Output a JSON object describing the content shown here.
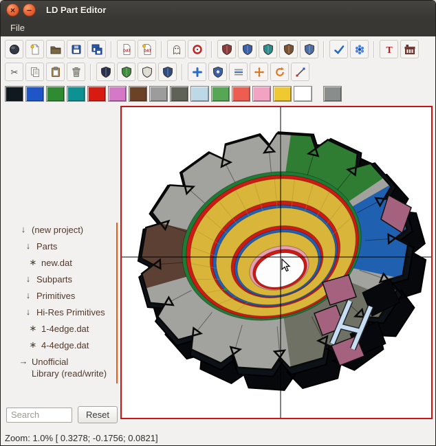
{
  "window": {
    "title": "LD Part Editor",
    "close_label": "×",
    "minimize_label": "–"
  },
  "menu": {
    "items": [
      {
        "label": "File"
      }
    ]
  },
  "toolbar_row1": {
    "items": [
      {
        "type": "button",
        "name": "manipulator-mode",
        "icon": "sphere"
      },
      {
        "type": "button",
        "name": "new-project",
        "icon": "page-new"
      },
      {
        "type": "button",
        "name": "open-file",
        "icon": "folder"
      },
      {
        "type": "button",
        "name": "save",
        "icon": "floppy"
      },
      {
        "type": "button",
        "name": "save-all",
        "icon": "floppy-multi"
      },
      {
        "type": "separator"
      },
      {
        "type": "button",
        "name": "new-dat-file",
        "icon": "dat"
      },
      {
        "type": "button",
        "name": "open-dat-file",
        "icon": "dat-star"
      },
      {
        "type": "separator"
      },
      {
        "type": "button",
        "name": "hide-ghost",
        "icon": "ghost"
      },
      {
        "type": "button",
        "name": "snap-to-grid",
        "icon": "red-ring"
      },
      {
        "type": "separator"
      },
      {
        "type": "button",
        "name": "shield-maroon",
        "icon": "shield",
        "color": "#8A3A3A"
      },
      {
        "type": "button",
        "name": "shield-blue",
        "icon": "shield",
        "color": "#3B5FA8"
      },
      {
        "type": "button",
        "name": "shield-teal",
        "icon": "shield",
        "color": "#2E8B8B"
      },
      {
        "type": "button",
        "name": "shield-brown",
        "icon": "shield",
        "color": "#7A5230"
      },
      {
        "type": "button",
        "name": "shield-steel",
        "icon": "shield",
        "color": "#4A6FA5"
      },
      {
        "type": "separator"
      },
      {
        "type": "button",
        "name": "select-check",
        "icon": "check"
      },
      {
        "type": "button",
        "name": "palette-flower",
        "icon": "flower"
      },
      {
        "type": "separator"
      },
      {
        "type": "button",
        "name": "text-editor",
        "icon": "letter-t"
      },
      {
        "type": "button",
        "name": "primgen",
        "icon": "factory"
      }
    ]
  },
  "toolbar_row2": {
    "items": [
      {
        "type": "button",
        "name": "cut",
        "icon": "scissors"
      },
      {
        "type": "button",
        "name": "copy",
        "icon": "copy"
      },
      {
        "type": "button",
        "name": "paste",
        "icon": "paste"
      },
      {
        "type": "button",
        "name": "delete",
        "icon": "trash"
      },
      {
        "type": "separator"
      },
      {
        "type": "button",
        "name": "shield-navy",
        "icon": "shield",
        "color": "#26324F"
      },
      {
        "type": "button",
        "name": "shield-green",
        "icon": "shield",
        "color": "#3F8C3F"
      },
      {
        "type": "button",
        "name": "shield-silver",
        "icon": "shield",
        "color": "#DCDCD4"
      },
      {
        "type": "button",
        "name": "shield-navy-2",
        "icon": "shield",
        "color": "#2F4A7F"
      },
      {
        "type": "separator"
      },
      {
        "type": "button",
        "name": "add-vertex",
        "icon": "plus"
      },
      {
        "type": "button",
        "name": "shield-marked",
        "icon": "shield-dot"
      },
      {
        "type": "button",
        "name": "line-mode",
        "icon": "lines"
      },
      {
        "type": "button",
        "name": "move-transform",
        "icon": "move"
      },
      {
        "type": "button",
        "name": "rotate-transform",
        "icon": "rotate"
      },
      {
        "type": "button",
        "name": "measure-diagonal",
        "icon": "slash"
      }
    ]
  },
  "palette": {
    "swatches": [
      {
        "name": "black",
        "hex": "#101820"
      },
      {
        "name": "blue",
        "hex": "#1E56C8"
      },
      {
        "name": "green",
        "hex": "#2E8B31"
      },
      {
        "name": "dark-turquoise",
        "hex": "#0D9193"
      },
      {
        "name": "red",
        "hex": "#D81B10"
      },
      {
        "name": "dark-pink",
        "hex": "#D678C8"
      },
      {
        "name": "brown",
        "hex": "#6B4226"
      },
      {
        "name": "light-gray",
        "hex": "#9C9C9C"
      },
      {
        "name": "dark-gray",
        "hex": "#5F6257"
      },
      {
        "name": "light-blue",
        "hex": "#BDD8E6"
      },
      {
        "name": "bright-green",
        "hex": "#57A656"
      },
      {
        "name": "salmon",
        "hex": "#EE5E50"
      },
      {
        "name": "pink",
        "hex": "#F2A2C2"
      },
      {
        "name": "yellow",
        "hex": "#F0C830"
      },
      {
        "name": "white",
        "hex": "#FFFFFF"
      }
    ],
    "main_color": {
      "name": "main-gray",
      "hex": "#898E8C"
    }
  },
  "sidebar": {
    "tree": {
      "items": [
        {
          "icon": "arrow-down",
          "label": "(new project)",
          "indent": 0
        },
        {
          "icon": "arrow-down",
          "label": "Parts",
          "indent": 1
        },
        {
          "icon": "asterisk",
          "label": "new.dat",
          "indent": 2
        },
        {
          "icon": "arrow-down",
          "label": "Subparts",
          "indent": 1
        },
        {
          "icon": "arrow-down",
          "label": "Primitives",
          "indent": 1
        },
        {
          "icon": "arrow-down",
          "label": "Hi-Res Primitives",
          "indent": 1
        },
        {
          "icon": "asterisk",
          "label": "1-4edge.dat",
          "indent": 2
        },
        {
          "icon": "asterisk",
          "label": "4-4edge.dat",
          "indent": 2
        },
        {
          "icon": "arrow-right",
          "label": "Unofficial\nLibrary (read/write)",
          "indent": 0
        }
      ]
    },
    "search": {
      "placeholder": "Search",
      "reset_label": "Reset"
    }
  },
  "viewport": {
    "zoom": "1.0%",
    "render_colors": {
      "background": "#FFFFFF",
      "border": "#C81414",
      "teeth_dark": "#06080C",
      "teeth_rim": "#0D1118",
      "face": "#A2A29E",
      "accent_green": "#2E7D33",
      "accent_blue": "#2060B0",
      "accent_brown": "#5C4033",
      "accent_gray": "#6E7164",
      "ring_green": "#1E7A34",
      "ring_red": "#CE1A12",
      "ring_yellow": "#D9B539",
      "ring_blue": "#2060B0",
      "ring_pink": "#E7A0B0",
      "hole_white": "#FDFDFD",
      "mauve": "#A4627F",
      "light_blue": "#C9DDF2"
    }
  },
  "statusbar": {
    "text": "Zoom: 1.0% [ 0.3278; -0.1756;  0.0821]"
  }
}
